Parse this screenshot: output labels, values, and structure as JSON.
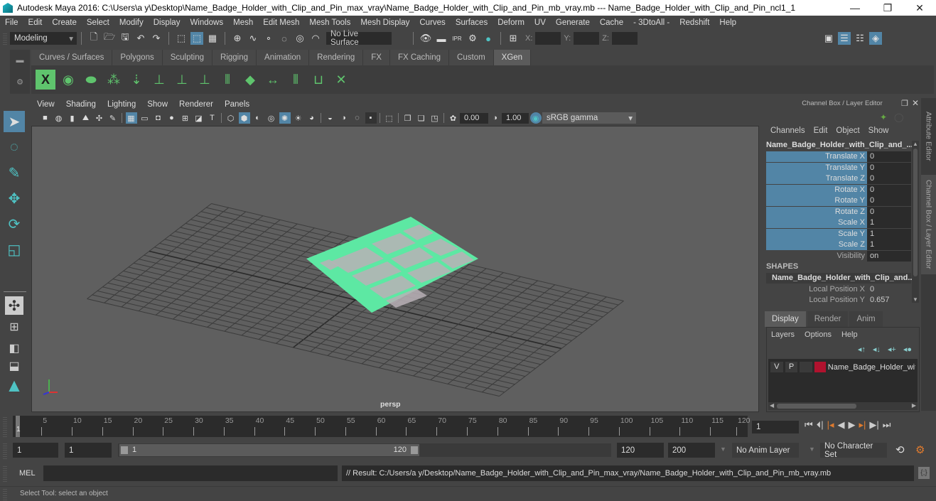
{
  "window": {
    "title": "Autodesk Maya 2016: C:\\Users\\a y\\Desktop\\Name_Badge_Holder_with_Clip_and_Pin_max_vray\\Name_Badge_Holder_with_Clip_and_Pin_mb_vray.mb  ---  Name_Badge_Holder_with_Clip_and_Pin_ncl1_1",
    "minimize": "—",
    "maximize": "❐",
    "close": "✕"
  },
  "menubar": [
    "File",
    "Edit",
    "Create",
    "Select",
    "Modify",
    "Display",
    "Windows",
    "Mesh",
    "Edit Mesh",
    "Mesh Tools",
    "Mesh Display",
    "Curves",
    "Surfaces",
    "Deform",
    "UV",
    "Generate",
    "Cache",
    "- 3DtoAll -",
    "Redshift",
    "Help"
  ],
  "statusline": {
    "mode": "Modeling",
    "live_surface": "No Live Surface",
    "x_label": "X:",
    "y_label": "Y:",
    "z_label": "Z:"
  },
  "shelf": {
    "tabs": [
      "Curves / Surfaces",
      "Polygons",
      "Sculpting",
      "Rigging",
      "Animation",
      "Rendering",
      "FX",
      "FX Caching",
      "Custom",
      "XGen"
    ],
    "active_tab": "XGen",
    "icons": [
      "xgen-window-icon",
      "xgen-preview-icon",
      "xgen-clear-preview-icon",
      "xgen-add-guides-icon",
      "xgen-place-guides-icon",
      "xgen-add-guide-icon",
      "xgen-show-guides-icon",
      "xgen-lock-guides-icon",
      "xgen-sculpt-guides-icon",
      "xgen-create-patch-icon",
      "xgen-bend-guides-icon",
      "xgen-select-guides-icon",
      "xgen-guide-region-icon",
      "xgen-delete-guides-icon"
    ]
  },
  "viewport": {
    "menu": [
      "View",
      "Shading",
      "Lighting",
      "Show",
      "Renderer",
      "Panels"
    ],
    "exposure": "0.00",
    "gamma": "1.00",
    "color_space": "sRGB gamma",
    "camera_label": "persp",
    "mesh_color": "#5de8a3",
    "grid_color": "#3c3c3c"
  },
  "channel_box": {
    "title": "Channel Box / Layer Editor",
    "menu": [
      "Channels",
      "Edit",
      "Object",
      "Show"
    ],
    "object_name": "Name_Badge_Holder_with_Clip_and_...",
    "channels": [
      {
        "label": "Translate X",
        "value": "0"
      },
      {
        "label": "Translate Y",
        "value": "0"
      },
      {
        "label": "Translate Z",
        "value": "0"
      },
      {
        "label": "Rotate X",
        "value": "0"
      },
      {
        "label": "Rotate Y",
        "value": "0"
      },
      {
        "label": "Rotate Z",
        "value": "0"
      },
      {
        "label": "Scale X",
        "value": "1"
      },
      {
        "label": "Scale Y",
        "value": "1"
      },
      {
        "label": "Scale Z",
        "value": "1"
      },
      {
        "label": "Visibility",
        "value": "on"
      }
    ],
    "shapes_header": "SHAPES",
    "shape_name": "Name_Badge_Holder_with_Clip_and...",
    "shape_attrs": [
      {
        "label": "Local Position X",
        "value": "0"
      },
      {
        "label": "Local Position Y",
        "value": "0.657"
      }
    ]
  },
  "side_tabs": [
    "Attribute Editor",
    "Channel Box / Layer Editor"
  ],
  "layer_editor": {
    "tabs": [
      "Display",
      "Render",
      "Anim"
    ],
    "active_tab": "Display",
    "menu": [
      "Layers",
      "Options",
      "Help"
    ],
    "layers": [
      {
        "v": "V",
        "p": "P",
        "color": "#b0122e",
        "name": "Name_Badge_Holder_wit"
      }
    ]
  },
  "timeline": {
    "ticks": [
      5,
      10,
      15,
      20,
      25,
      30,
      35,
      40,
      45,
      50,
      55,
      60,
      65,
      70,
      75,
      80,
      85,
      90,
      95,
      100,
      105,
      110,
      115,
      120
    ],
    "current_frame_label": "1",
    "current_frame": "1",
    "range_max": 120
  },
  "range": {
    "start": "1",
    "anim_start": "1",
    "slider_start": "1",
    "slider_end": "120",
    "anim_end": "120",
    "end": "200",
    "anim_layer": "No Anim Layer",
    "character_set": "No Character Set"
  },
  "command_line": {
    "label": "MEL",
    "input": "",
    "result": "// Result: C:/Users/a y/Desktop/Name_Badge_Holder_with_Clip_and_Pin_max_vray/Name_Badge_Holder_with_Clip_and_Pin_mb_vray.mb"
  },
  "help_line": "Select Tool: select an object"
}
